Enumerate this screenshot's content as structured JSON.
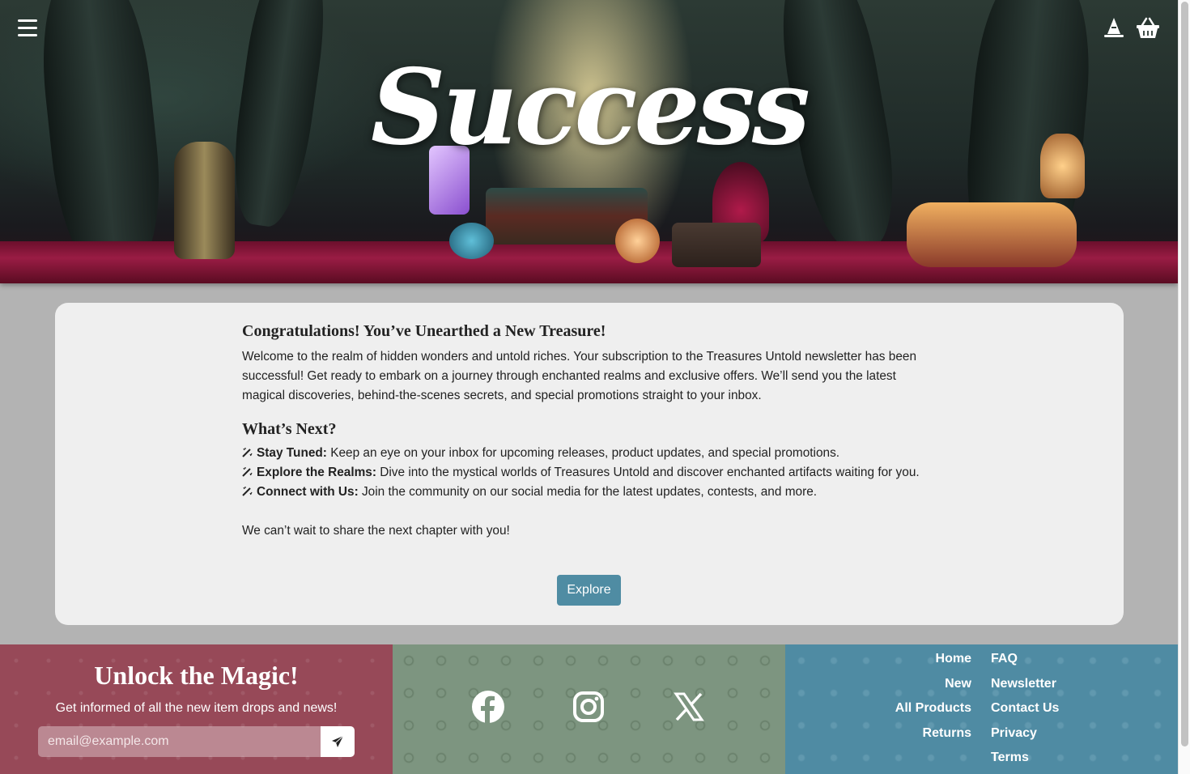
{
  "hero": {
    "title": "Success"
  },
  "header": {
    "menu_icon": "hamburger-menu-icon",
    "account_icon": "wizard-hat-icon",
    "cart_icon": "basket-icon"
  },
  "content": {
    "heading": "Congratulations! You’ve Unearthed a New Treasure!",
    "intro": "Welcome to the realm of hidden wonders and untold riches. Your subscription to the Treasures Untold newsletter has been successful! Get ready to embark on a journey through enchanted realms and exclusive offers. We’ll send you the latest magical discoveries, behind-the-scenes secrets, and special promotions straight to your inbox.",
    "next_heading": "What’s Next?",
    "next_items": [
      {
        "title": "Stay Tuned:",
        "text": " Keep an eye on your inbox for upcoming releases, product updates, and special promotions."
      },
      {
        "title": "Explore the Realms:",
        "text": " Dive into the mystical worlds of Treasures Untold and discover enchanted artifacts waiting for you."
      },
      {
        "title": "Connect with Us:",
        "text": " Join the community on our social media for the latest updates, contests, and more."
      }
    ],
    "closing": "We can’t wait to share the next chapter with you!",
    "explore_label": "Explore"
  },
  "footer": {
    "newsletter": {
      "title": "Unlock the Magic!",
      "subtitle": "Get informed of all the new item drops and news!",
      "email_placeholder": "email@example.com",
      "send_icon": "paper-plane-icon"
    },
    "social": [
      "facebook-icon",
      "instagram-icon",
      "x-icon"
    ],
    "links_left": [
      "Home",
      "New",
      "All Products",
      "Returns"
    ],
    "links_right": [
      "FAQ",
      "Newsletter",
      "Contact Us",
      "Privacy",
      "Terms"
    ]
  },
  "colors": {
    "accent": "#4f8ca3",
    "footer_red": "#974958",
    "footer_green": "#7d9580",
    "footer_blue": "#4f8ba3",
    "card_bg": "#efefef"
  }
}
